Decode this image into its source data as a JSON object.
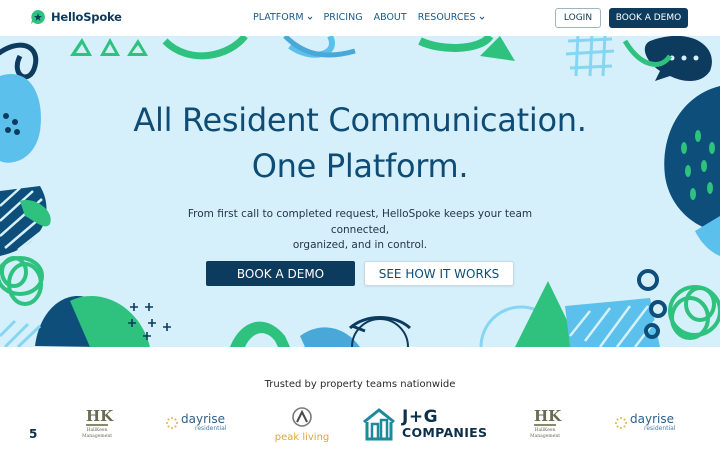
{
  "nav": {
    "brand": "HelloSpoke",
    "links": [
      {
        "label": "PLATFORM",
        "dropdown": true
      },
      {
        "label": "PRICING",
        "dropdown": false
      },
      {
        "label": "ABOUT",
        "dropdown": false
      },
      {
        "label": "RESOURCES",
        "dropdown": true
      }
    ],
    "login_label": "LOGIN",
    "demo_label": "BOOK A DEMO"
  },
  "hero": {
    "title_line1": "All Resident Communication.",
    "title_line2": "One Platform.",
    "subtitle_line1": "From first call to completed request, HelloSpoke keeps your team connected,",
    "subtitle_line2": "organized, and in control.",
    "primary_cta": "BOOK A DEMO",
    "secondary_cta": "SEE HOW IT WORKS"
  },
  "trusted": {
    "heading": "Trusted by property teams nationwide",
    "partial_glyph": "5",
    "logos": [
      {
        "name": "HK",
        "sub": "HallKeen Management"
      },
      {
        "name": "dayrise",
        "sub": "residential"
      },
      {
        "name": "peak living"
      },
      {
        "name": "J+G",
        "sub": "COMPANIES"
      },
      {
        "name": "HK",
        "sub": "HallKeen Management"
      },
      {
        "name": "dayrise",
        "sub": "residential"
      }
    ]
  },
  "colors": {
    "brand_navy": "#0d3b5e",
    "hero_bg": "#d5f0fb",
    "accent_green": "#2ec27e",
    "accent_blue": "#5bc0eb"
  }
}
